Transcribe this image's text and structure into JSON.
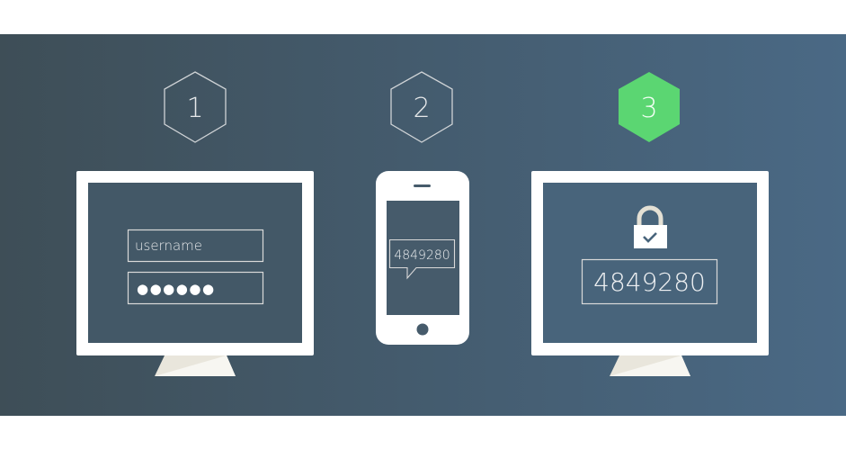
{
  "steps": [
    {
      "number": "1",
      "active": false
    },
    {
      "number": "2",
      "active": false
    },
    {
      "number": "3",
      "active": true
    }
  ],
  "step1": {
    "username_placeholder": "username",
    "password_dots": "●●●●●●"
  },
  "step2": {
    "sms_code": "4849280"
  },
  "step3": {
    "entered_code": "4849280",
    "icon": "lock-check-icon"
  },
  "colors": {
    "background_left": "#3e4e57",
    "background_right": "#4a6985",
    "active_step": "#5bd672",
    "device": "#ffffff",
    "stand": "#e9e6dc",
    "outline": "#d9d9d9"
  }
}
